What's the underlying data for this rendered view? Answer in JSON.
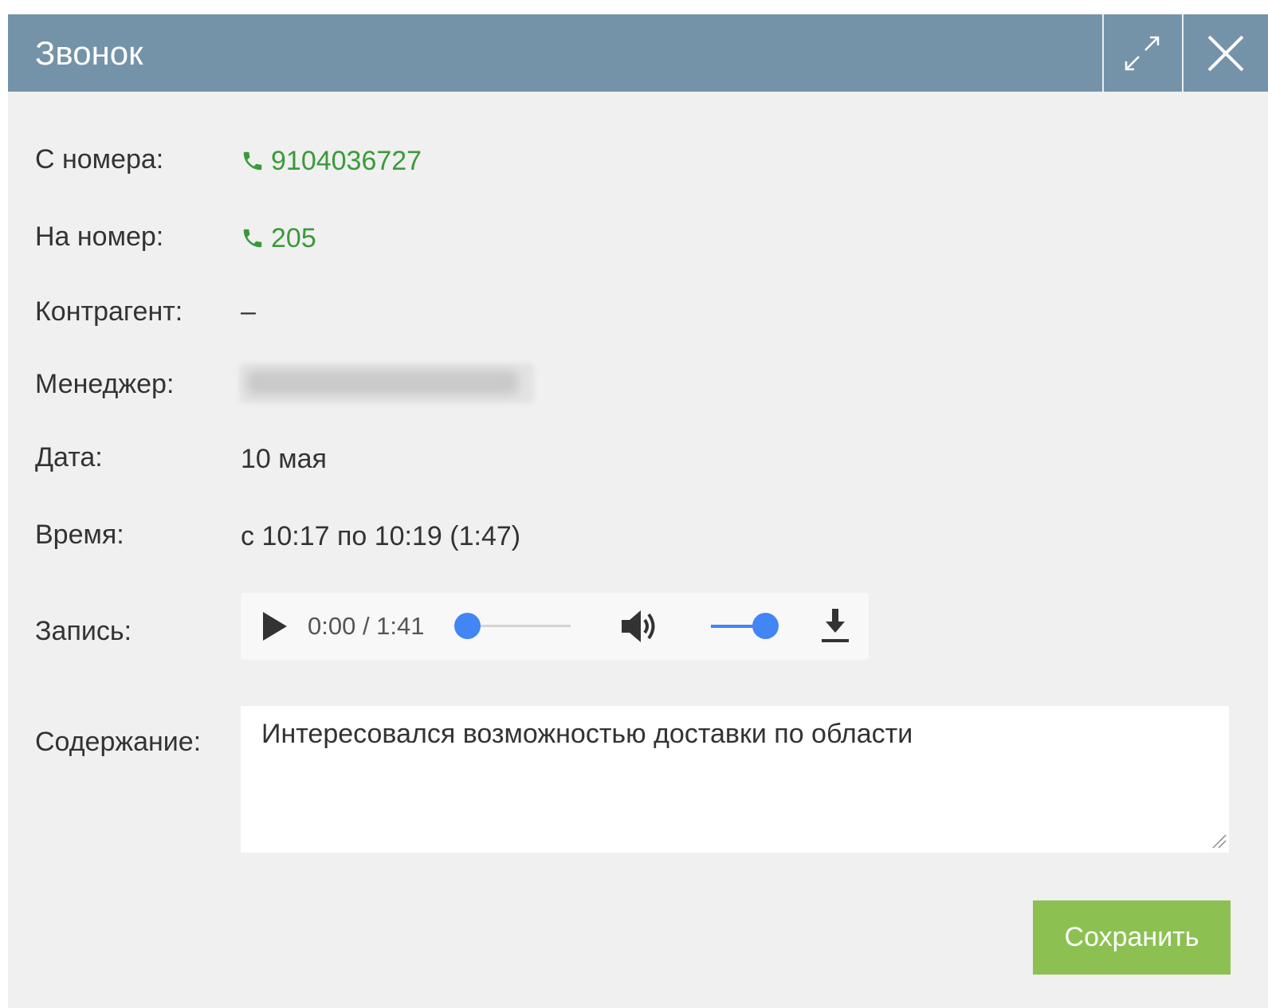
{
  "dialog": {
    "title": "Звонок"
  },
  "fields": {
    "from_label": "С номера:",
    "from_value": "9104036727",
    "to_label": "На номер:",
    "to_value": "205",
    "counterparty_label": "Контрагент:",
    "counterparty_value": "–",
    "manager_label": "Менеджер:",
    "date_label": "Дата:",
    "date_value": "10 мая",
    "time_label": "Время:",
    "time_value": "с 10:17 по 10:19 (1:47)",
    "recording_label": "Запись:",
    "content_label": "Содержание:",
    "content_value": "Интересовался возможностью доставки по области"
  },
  "player": {
    "time_display": "0:00 / 1:41",
    "progress": 0.0,
    "volume": 1.0
  },
  "actions": {
    "save_label": "Сохранить"
  },
  "colors": {
    "titlebar": "#7593a8",
    "phone_link": "#3a9a3a",
    "save_button": "#8cc152",
    "player_accent": "#4285f4"
  }
}
